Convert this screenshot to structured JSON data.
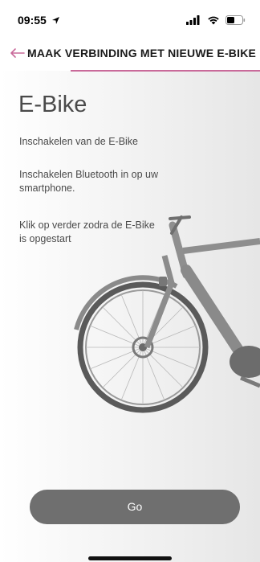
{
  "status": {
    "time": "09:55"
  },
  "header": {
    "title": "MAAK VERBINDING MET NIEUWE E-BIKE",
    "accent_color": "#c96a9a"
  },
  "content": {
    "heading": "E-Bike",
    "paragraphs": [
      "Inschakelen van de E-Bike",
      "Inschakelen Bluetooth in op uw smartphone.",
      "Klik op verder zodra de E-Bike is opgestart"
    ]
  },
  "actions": {
    "go_label": "Go"
  }
}
